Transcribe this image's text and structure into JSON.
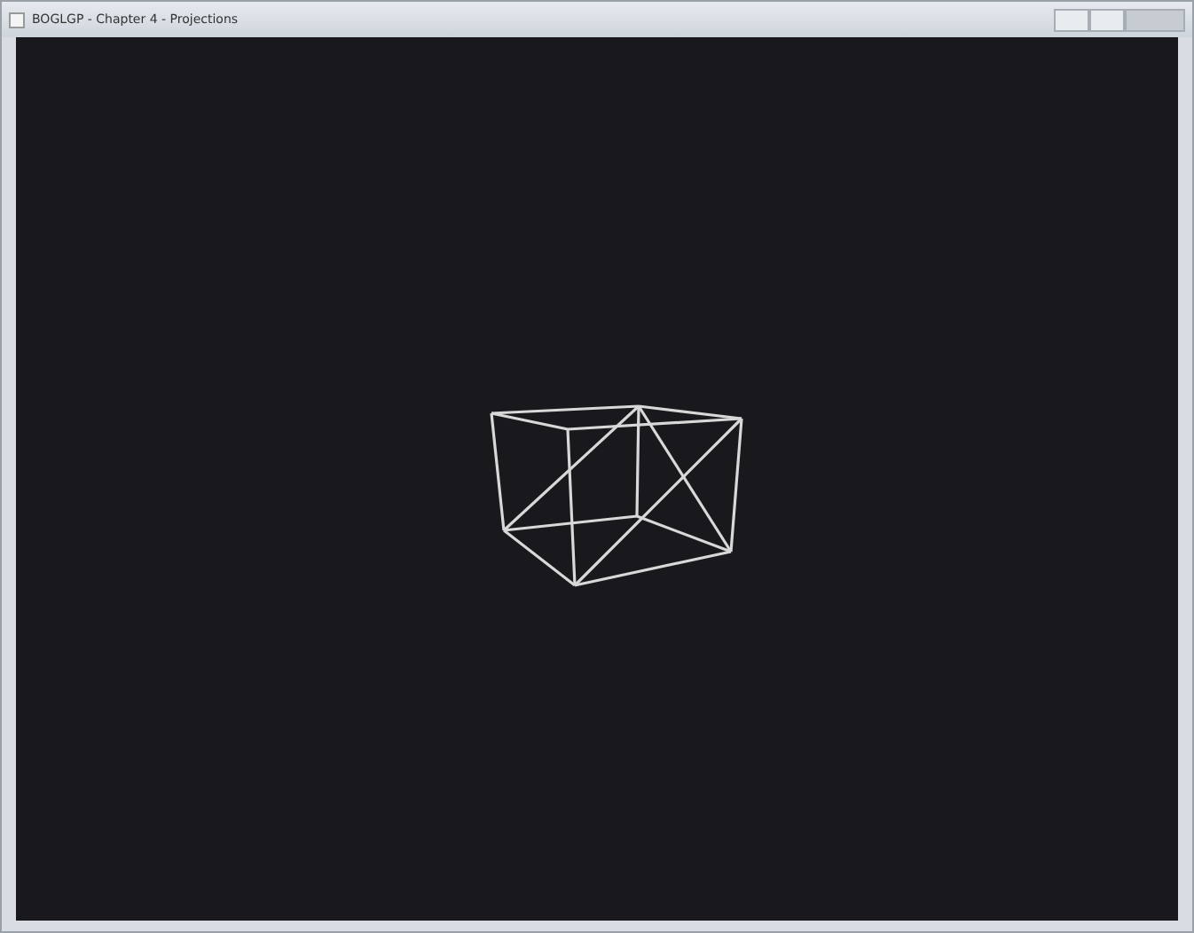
{
  "window": {
    "title": "BOGLGP - Chapter 4 - Projections"
  }
}
